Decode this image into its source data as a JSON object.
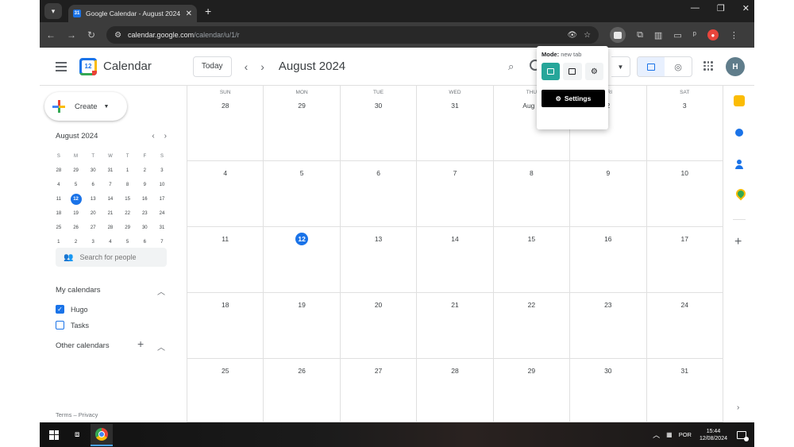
{
  "browser": {
    "tab_title": "Google Calendar - August 2024",
    "url_domain": "calendar.google.com",
    "url_path": "/calendar/u/1/r"
  },
  "header": {
    "app_name": "Calendar",
    "today_label": "Today",
    "month_title": "August 2024"
  },
  "avatar_initial": "H",
  "sidebar": {
    "create_label": "Create",
    "mini_month_title": "August 2024",
    "dow": [
      "S",
      "M",
      "T",
      "W",
      "T",
      "F",
      "S"
    ],
    "mini_weeks": [
      [
        "28",
        "29",
        "30",
        "31",
        "1",
        "2",
        "3"
      ],
      [
        "4",
        "5",
        "6",
        "7",
        "8",
        "9",
        "10"
      ],
      [
        "11",
        "12",
        "13",
        "14",
        "15",
        "16",
        "17"
      ],
      [
        "18",
        "19",
        "20",
        "21",
        "22",
        "23",
        "24"
      ],
      [
        "25",
        "26",
        "27",
        "28",
        "29",
        "30",
        "31"
      ],
      [
        "1",
        "2",
        "3",
        "4",
        "5",
        "6",
        "7"
      ]
    ],
    "search_people_placeholder": "Search for people",
    "my_calendars_title": "My calendars",
    "calendars": [
      {
        "label": "Hugo",
        "checked": true
      },
      {
        "label": "Tasks",
        "checked": false
      }
    ],
    "other_calendars_title": "Other calendars",
    "footer": "Terms – Privacy"
  },
  "month_grid": {
    "dow_labels": [
      "SUN",
      "MON",
      "TUE",
      "WED",
      "THU",
      "FRI",
      "SAT"
    ],
    "weeks": [
      [
        "28",
        "29",
        "30",
        "31",
        "Aug 1",
        "2",
        "3"
      ],
      [
        "4",
        "5",
        "6",
        "7",
        "8",
        "9",
        "10"
      ],
      [
        "11",
        "12",
        "13",
        "14",
        "15",
        "16",
        "17"
      ],
      [
        "18",
        "19",
        "20",
        "21",
        "22",
        "23",
        "24"
      ],
      [
        "25",
        "26",
        "27",
        "28",
        "29",
        "30",
        "31"
      ]
    ],
    "today": "12"
  },
  "popup": {
    "mode_label": "Mode:",
    "mode_value": "new tab",
    "settings_label": "Settings"
  },
  "taskbar": {
    "lang": "POR",
    "time": "15:44",
    "date": "12/08/2024"
  },
  "colors": {
    "accent": "#1a73e8",
    "popup_active": "#26a69a"
  }
}
